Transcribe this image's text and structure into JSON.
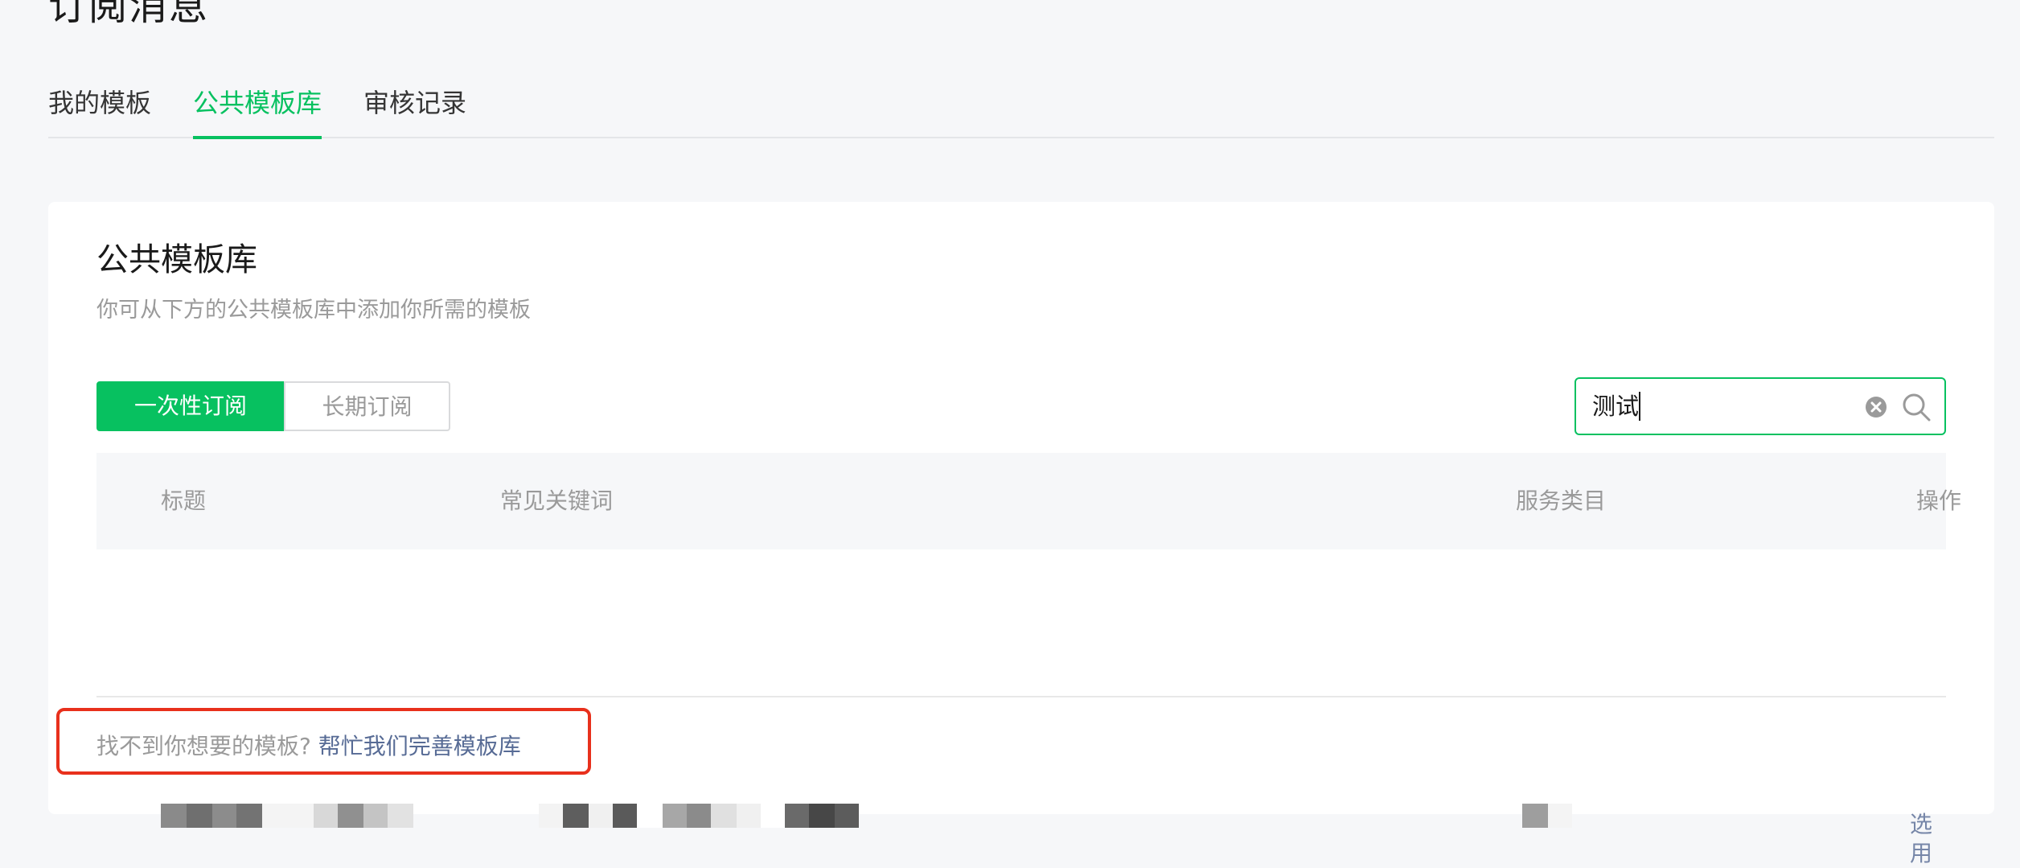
{
  "page": {
    "title": "订阅消息"
  },
  "tabs": [
    {
      "label": "我的模板"
    },
    {
      "label": "公共模板库"
    },
    {
      "label": "审核记录"
    }
  ],
  "card": {
    "title": "公共模板库",
    "subtitle": "你可从下方的公共模板库中添加你所需的模板"
  },
  "subscription_type": {
    "options": [
      "一次性订阅",
      "长期订阅"
    ],
    "selected": "一次性订阅"
  },
  "search": {
    "value": "测试"
  },
  "table": {
    "headers": [
      "标题",
      "常见关键词",
      "服务类目",
      "操作"
    ],
    "rows": [
      {
        "action": "选用"
      }
    ]
  },
  "footer": {
    "text": "找不到你想要的模板?",
    "link": "帮忙我们完善模板库"
  },
  "colors": {
    "accent": "#07c160",
    "link": "#576b95",
    "highlight": "#e8301c"
  },
  "icons": [
    "clear-icon",
    "search-icon"
  ]
}
